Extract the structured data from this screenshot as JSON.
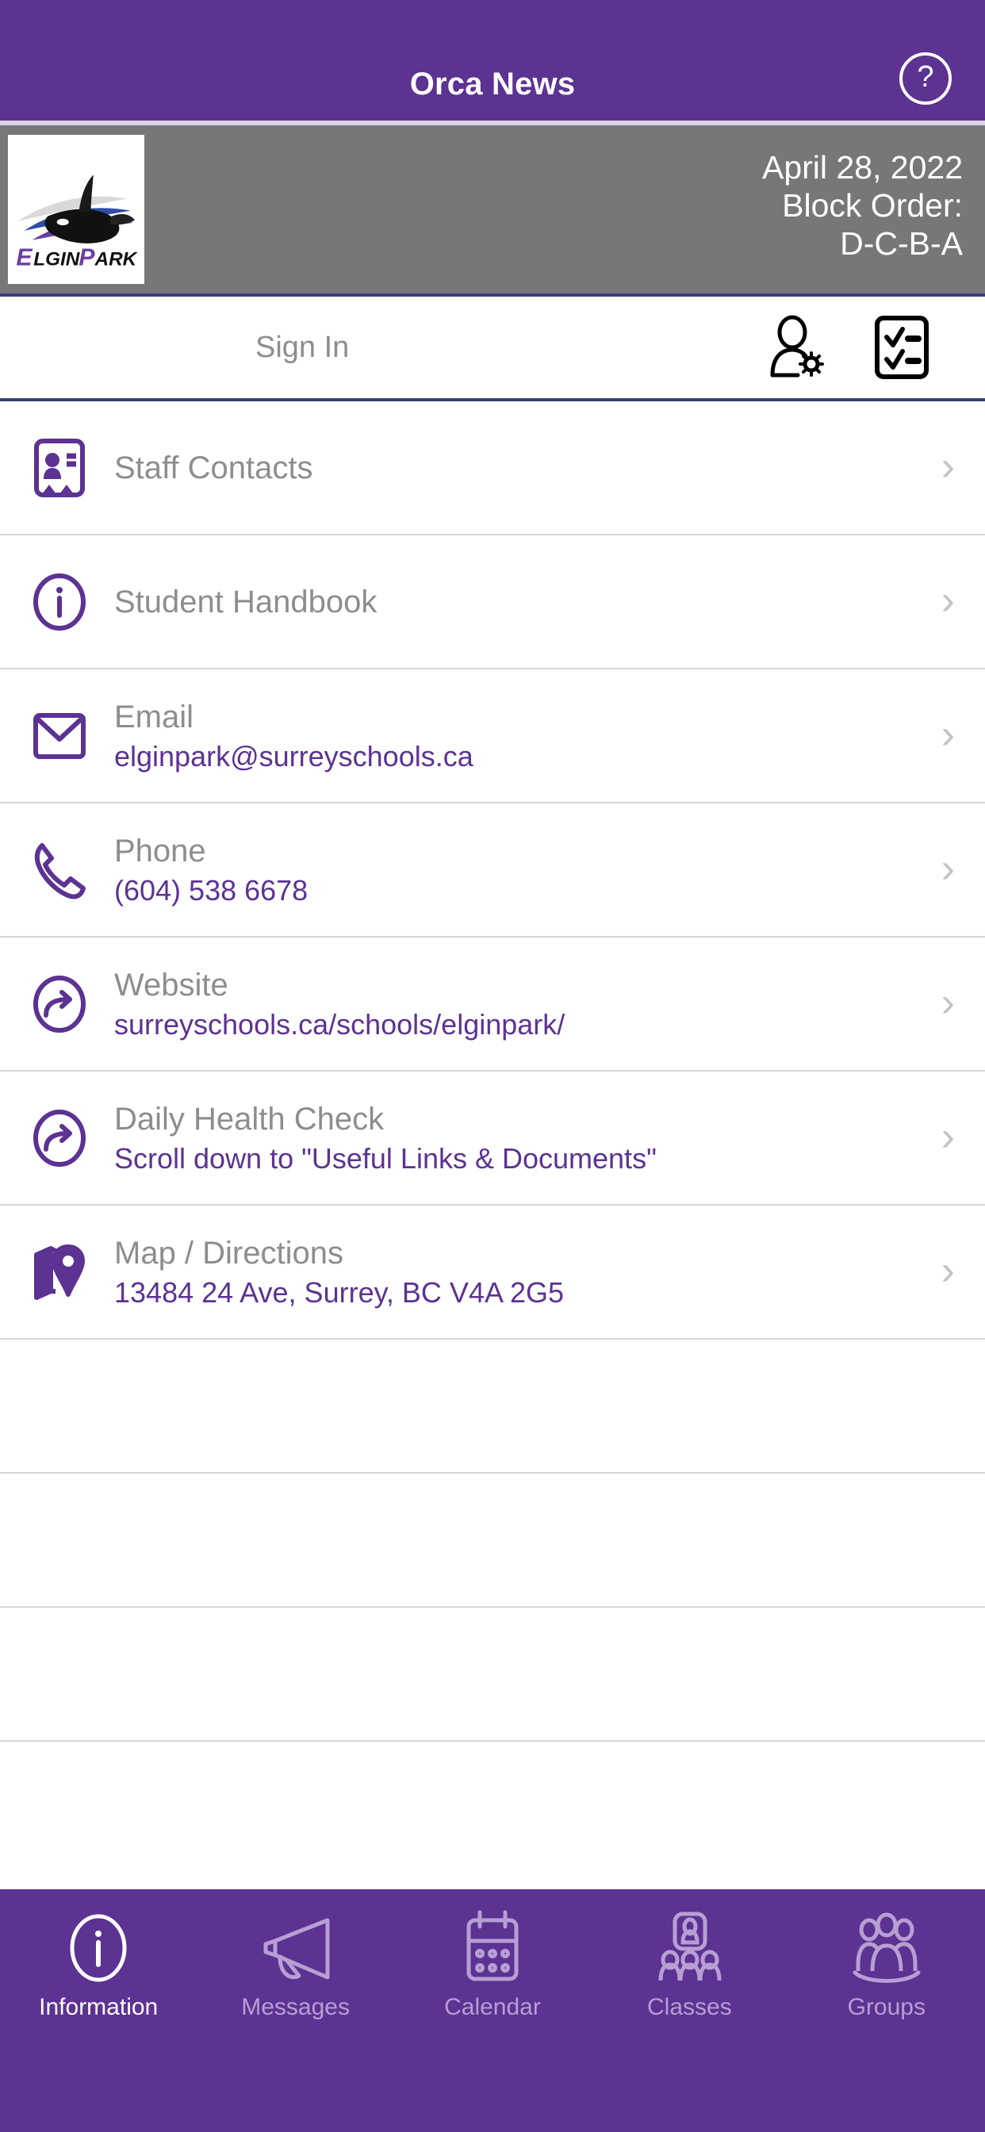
{
  "theme": {
    "purple": "#5C3292",
    "gray_banner": "#777777",
    "title_gray": "#8d8d8d",
    "divider": "#d6d6d6"
  },
  "topnav": {
    "title": "Orca News",
    "help_icon": "question-mark-circle-icon",
    "help_glyph": "?"
  },
  "banner": {
    "logo_alt": "ELGINPARK",
    "logo_text_primary": "ELGIN",
    "logo_text_secondary": "PARK",
    "date": "April 28, 2022",
    "block_label": "Block Order:",
    "block_value": "D-C-B-A"
  },
  "signin": {
    "label": "Sign In",
    "user_settings_icon": "user-settings-icon",
    "checklist_icon": "checklist-icon"
  },
  "list": {
    "items": [
      {
        "icon": "contact-card-icon",
        "title": "Staff Contacts",
        "subtitle": "",
        "chevron": "›"
      },
      {
        "icon": "info-circle-icon",
        "title": "Student Handbook",
        "subtitle": "",
        "chevron": "›"
      },
      {
        "icon": "envelope-icon",
        "title": "Email",
        "subtitle": "elginpark@surreyschools.ca",
        "chevron": "›"
      },
      {
        "icon": "phone-icon",
        "title": "Phone",
        "subtitle": "(604) 538 6678",
        "chevron": "›"
      },
      {
        "icon": "external-link-circle-icon",
        "title": "Website",
        "subtitle": "surreyschools.ca/schools/elginpark/",
        "chevron": "›"
      },
      {
        "icon": "external-link-circle-icon",
        "title": "Daily Health Check",
        "subtitle": "Scroll down to \"Useful Links & Documents\"",
        "chevron": "›"
      },
      {
        "icon": "map-pin-icon",
        "title": "Map / Directions",
        "subtitle": "13484 24 Ave, Surrey, BC V4A 2G5",
        "chevron": "›"
      }
    ],
    "empty_rows": 3
  },
  "tabbar": {
    "tabs": [
      {
        "label": "Information",
        "icon": "info-circle-icon",
        "active": true
      },
      {
        "label": "Messages",
        "icon": "megaphone-icon",
        "active": false
      },
      {
        "label": "Calendar",
        "icon": "calendar-icon",
        "active": false
      },
      {
        "label": "Classes",
        "icon": "classes-people-icon",
        "active": false
      },
      {
        "label": "Groups",
        "icon": "groups-people-icon",
        "active": false
      }
    ]
  }
}
